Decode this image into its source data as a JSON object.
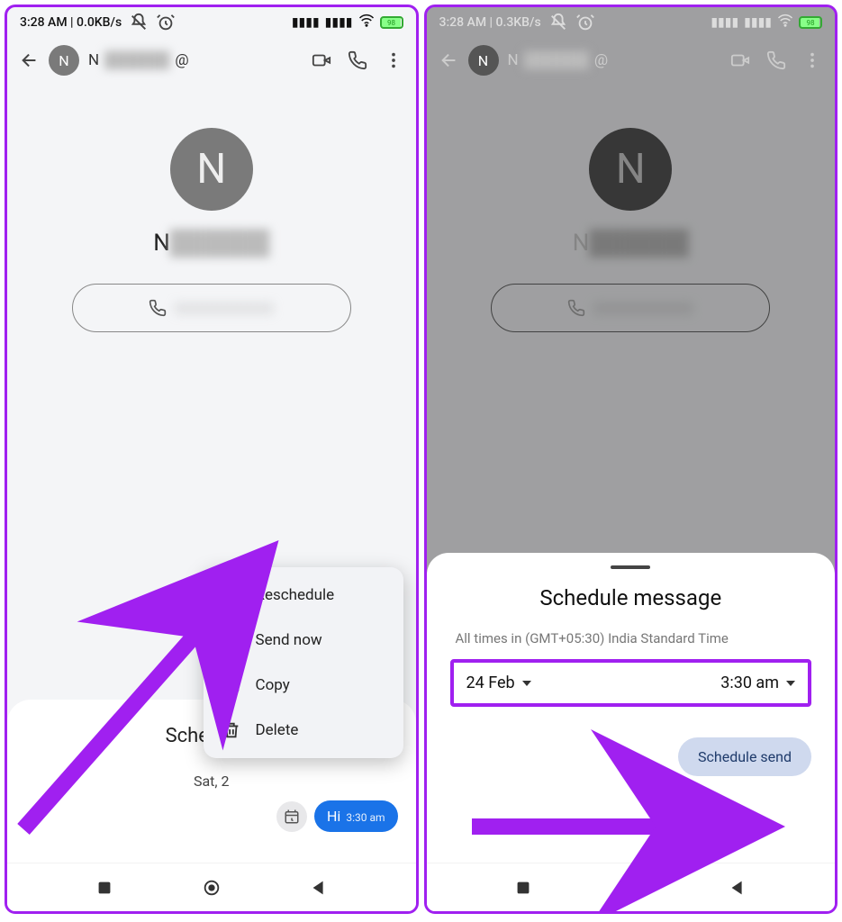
{
  "status": {
    "time_label_left": "3:28 AM | 0.0KB/s",
    "time_label_right": "3:28 AM | 0.3KB/s",
    "battery": "98"
  },
  "header": {
    "avatar_letter": "N",
    "title_letter": "N",
    "at_symbol": "@"
  },
  "contact": {
    "big_letter": "N",
    "name_letter": "N"
  },
  "left_panel": {
    "scheduled_title": "Scheduled",
    "scheduled_date": "Sat, 2",
    "msg_text": "Hi",
    "msg_time": "3:30 am",
    "menu": {
      "reschedule": "Reschedule",
      "send_now": "Send now",
      "copy": "Copy",
      "delete": "Delete"
    }
  },
  "right_sheet": {
    "title": "Schedule message",
    "note": "All times in (GMT+05:30) India Standard Time",
    "date": "24 Feb",
    "time": "3:30 am",
    "button": "Schedule send"
  }
}
